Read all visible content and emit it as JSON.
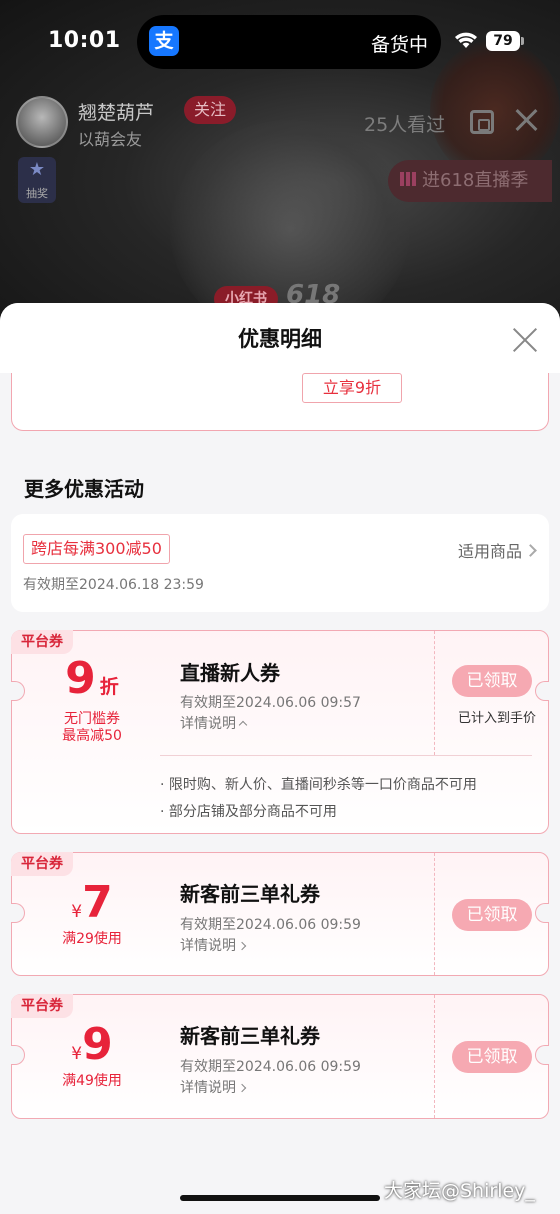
{
  "status_bar": {
    "time": "10:01",
    "island_text": "备货中",
    "app_icon_glyph": "支",
    "battery": "79"
  },
  "live": {
    "host_name": "翘楚葫芦",
    "host_subtitle": "以葫会友",
    "follow_label": "关注",
    "viewers": "25人看过",
    "lottery_label": "抽奖",
    "lottery_icon": "star-icon",
    "enter_618_label": "进618直播季",
    "banner_brand": "小红书",
    "banner_618": "618"
  },
  "sheet": {
    "title": "优惠明细",
    "top_button": "立享9折",
    "section_title": "更多优惠活动",
    "promo": {
      "tag": "跨店每满300减50",
      "applicable": "适用商品",
      "validity": "有效期至2024.06.18 23:59"
    },
    "coupons": [
      {
        "badge": "平台券",
        "currency": "",
        "amount": "9",
        "unit": "折",
        "sub1": "无门槛券",
        "sub2": "最高减50",
        "title": "直播新人券",
        "validity": "有效期至2024.06.06 09:57",
        "detail": "详情说明",
        "button": "已领取",
        "note": "已计入到手价",
        "rules": [
          "· 限时购、新人价、直播间秒杀等一口价商品不可用",
          "· 部分店铺及部分商品不可用"
        ]
      },
      {
        "badge": "平台券",
        "currency": "¥",
        "amount": "7",
        "unit": "",
        "sub1": "满29使用",
        "title": "新客前三单礼券",
        "validity": "有效期至2024.06.06 09:59",
        "detail": "详情说明",
        "button": "已领取"
      },
      {
        "badge": "平台券",
        "currency": "¥",
        "amount": "9",
        "unit": "",
        "sub1": "满49使用",
        "title": "新客前三单礼券",
        "validity": "有效期至2024.06.06 09:59",
        "detail": "详情说明",
        "button": "已领取"
      }
    ]
  },
  "watermark": "大家坛@Shirley_",
  "colors": {
    "accent": "#e7233a",
    "claimed_button": "#f6a9b2",
    "coupon_border": "#f2a9b3"
  }
}
